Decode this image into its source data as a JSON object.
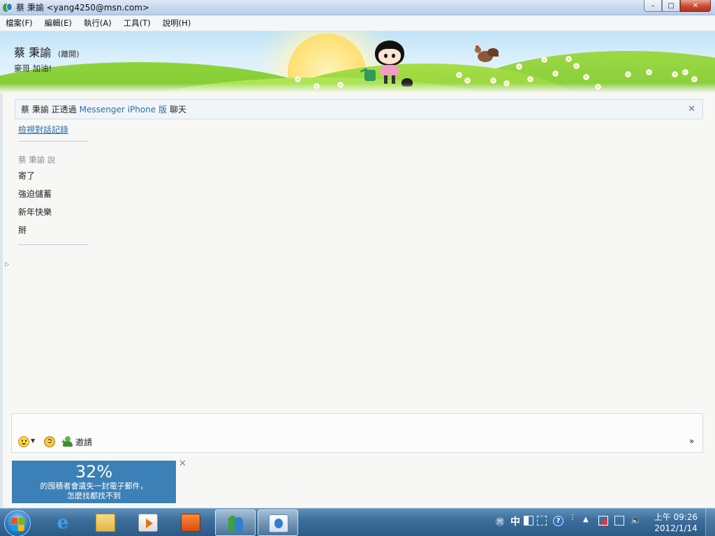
{
  "window": {
    "title": "蔡 秉諭 <yang4250@msn.com>",
    "controls": {
      "minimize": "–",
      "maximize": "□",
      "close": "✕"
    }
  },
  "menu": [
    "檔案(F)",
    "編輯(E)",
    "執行(A)",
    "工具(T)",
    "說明(H)"
  ],
  "contact": {
    "name": "蔡 秉諭",
    "status": "(離開)",
    "personal_message": "豪哥 加油!"
  },
  "info_bar": {
    "prefix": "蔡 秉諭 正透過",
    "link": "Messenger iPhone 版",
    "suffix": "聊天",
    "close": "✕"
  },
  "conversation": {
    "history_link": "檢視對話記錄",
    "sender_line": "蔡 秉諭 說",
    "messages": [
      "寄了",
      "強迫儲蓄",
      "新年快樂",
      "掰"
    ]
  },
  "compose_toolbar": {
    "emoticon_caret": "▼",
    "wink_glyph": "➲",
    "invite_label": "邀請",
    "more": "»"
  },
  "ad": {
    "headline": "32%",
    "line1": "的囤積者會遺失一封電子郵件，",
    "line2": "怎麼找都找不到",
    "close": "✕"
  },
  "taskbar": {
    "tray": {
      "ime": "中",
      "help": "?"
    },
    "clock": {
      "time": "上午 09:26",
      "date": "2012/1/14"
    }
  },
  "icons": {
    "side_arrow": "▷",
    "tray_volume": "🔈"
  },
  "colors": {
    "link_blue": "#2c6ea8",
    "ad_background": "#3b80b6",
    "taskbar": "#3d6f9c"
  }
}
